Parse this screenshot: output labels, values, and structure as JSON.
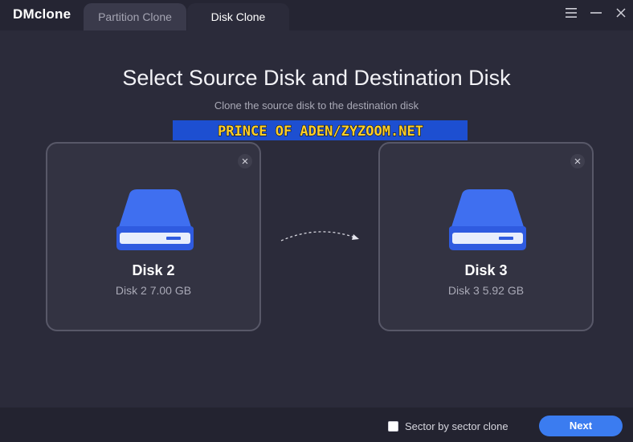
{
  "app": {
    "name": "DMclone"
  },
  "tabs": [
    {
      "label": "Partition Clone",
      "active": false
    },
    {
      "label": "Disk Clone",
      "active": true
    }
  ],
  "window_controls": {
    "icons": [
      "menu-icon",
      "minimize-icon",
      "close-icon"
    ]
  },
  "header": {
    "title": "Select Source Disk and Destination Disk",
    "subtitle": "Clone the source disk to the destination disk"
  },
  "watermark": {
    "text": "PRINCE OF ADEN/ZYZOOM.NET"
  },
  "source_disk": {
    "name": "Disk 2",
    "info": "Disk 2 7.00 GB"
  },
  "destination_disk": {
    "name": "Disk 3",
    "info": "Disk 3 5.92 GB"
  },
  "footer": {
    "sector_option": {
      "label": "Sector by sector clone",
      "checked": false
    },
    "next_label": "Next"
  },
  "colors": {
    "background": "#2b2b3a",
    "accent": "#3b7cf0",
    "disk_blue": "#3f6ff0"
  }
}
